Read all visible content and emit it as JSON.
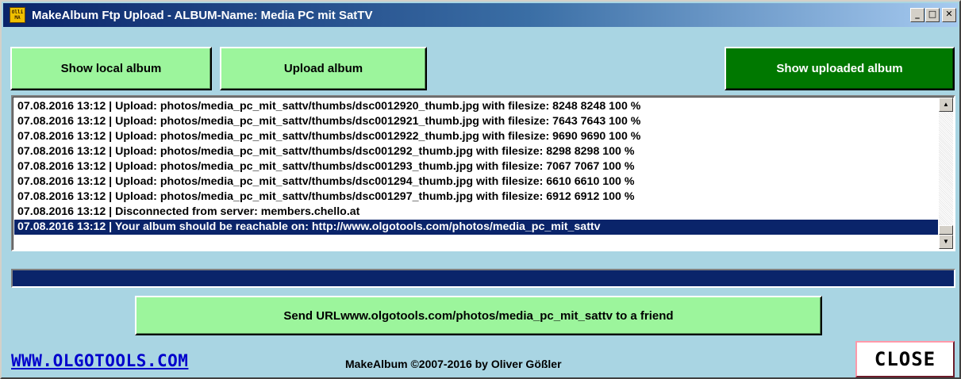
{
  "window": {
    "title": "MakeAlbum Ftp Upload -  ALBUM-Name: Media PC mit SatTV",
    "icon_text": "Olli MA",
    "controls": {
      "minimize": "_",
      "maximize": "□",
      "close": "✕"
    }
  },
  "toolbar": {
    "show_local_album": "Show local album",
    "upload_album": "Upload album",
    "show_uploaded_album": "Show uploaded album"
  },
  "log": {
    "rows": [
      "07.08.2016 13:12 | Upload: photos/media_pc_mit_sattv/thumbs/dsc0012920_thumb.jpg with filesize: 8248 8248 100 %",
      "07.08.2016 13:12 | Upload: photos/media_pc_mit_sattv/thumbs/dsc0012921_thumb.jpg with filesize: 7643 7643 100 %",
      "07.08.2016 13:12 | Upload: photos/media_pc_mit_sattv/thumbs/dsc0012922_thumb.jpg with filesize: 9690 9690 100 %",
      "07.08.2016 13:12 | Upload: photos/media_pc_mit_sattv/thumbs/dsc001292_thumb.jpg with filesize: 8298 8298 100 %",
      "07.08.2016 13:12 | Upload: photos/media_pc_mit_sattv/thumbs/dsc001293_thumb.jpg with filesize: 7067 7067 100 %",
      "07.08.2016 13:12 | Upload: photos/media_pc_mit_sattv/thumbs/dsc001294_thumb.jpg with filesize: 6610 6610 100 %",
      "07.08.2016 13:12 | Upload: photos/media_pc_mit_sattv/thumbs/dsc001297_thumb.jpg with filesize: 6912 6912 100 %",
      "07.08.2016 13:12 | Disconnected from server: members.chello.at",
      "07.08.2016 13:12 | Your album should be reachable on: http://www.olgotools.com/photos/media_pc_mit_sattv"
    ],
    "selected_index": 8,
    "scroll_up_icon": "▲",
    "scroll_down_icon": "▼"
  },
  "progress": {
    "fraction": 1.0
  },
  "send_url_label": "Send URLwww.olgotools.com/photos/media_pc_mit_sattv to a friend",
  "footer": {
    "site_link": "WWW.OLGOTOOLS.COM",
    "copyright": "MakeAlbum ©2007-2016 by Oliver Gößler",
    "close_label": "CLOSE"
  },
  "colors": {
    "window_bg": "#a9d5e3",
    "button_green": "#9cf59c",
    "button_dark_green": "#007800",
    "selection": "#0a246a",
    "link": "#0000cc"
  }
}
